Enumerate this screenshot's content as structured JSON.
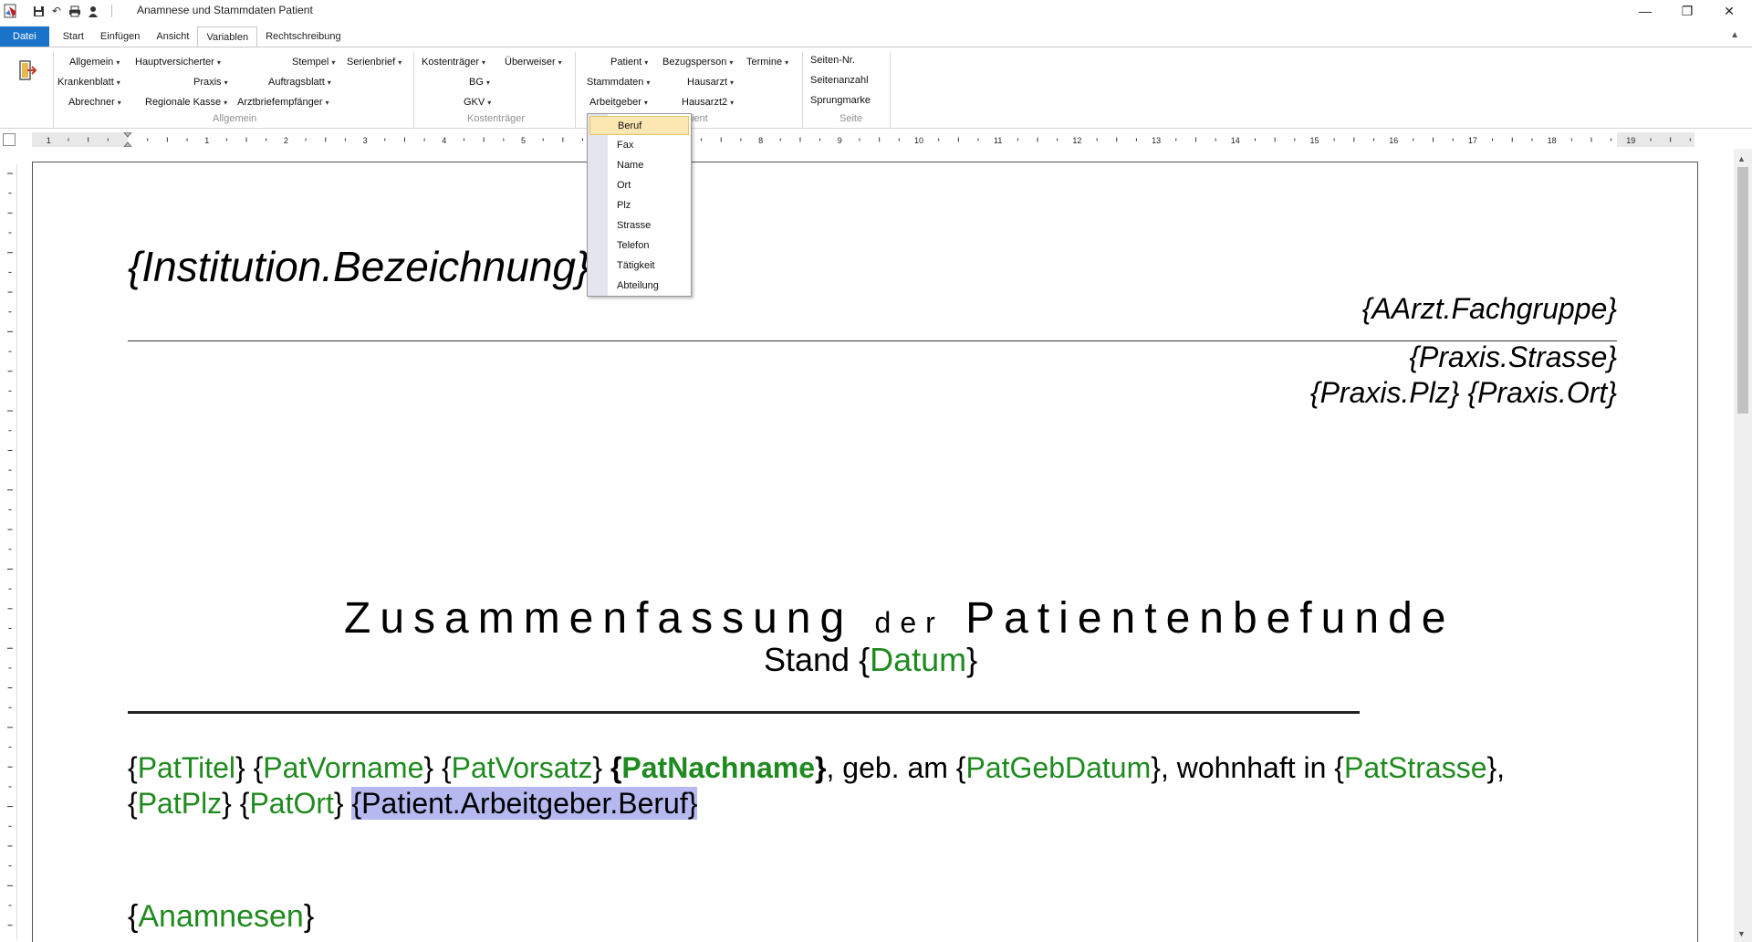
{
  "window": {
    "title": "Anamnese und Stammdaten Patient",
    "controls": {
      "minimize": "—",
      "restore": "❐",
      "close": "✕"
    }
  },
  "tabs": [
    {
      "label": "Datei"
    },
    {
      "label": "Start"
    },
    {
      "label": "Einfügen"
    },
    {
      "label": "Ansicht"
    },
    {
      "label": "Variablen"
    },
    {
      "label": "Rechtschreibung"
    }
  ],
  "ribbon": {
    "allgemein": {
      "items": [
        "Allgemein",
        "Hauptversicherter",
        "Stempel",
        "Serienbrief",
        "Krankenblatt",
        "Praxis",
        "Auftragsblatt",
        "Abrechner",
        "Regionale Kasse",
        "Arztbriefempfänger"
      ],
      "group_label": "Allgemein"
    },
    "kostentraeger": {
      "items": [
        "Kostenträger",
        "Überweiser",
        "BG",
        "GKV"
      ],
      "group_label": "Kostenträger"
    },
    "patient": {
      "items": [
        "Patient",
        "Bezugsperson",
        "Termine",
        "Stammdaten",
        "Hausarzt",
        "Arbeitgeber",
        "Hausarzt2"
      ],
      "group_label": "ient"
    },
    "seite": {
      "items": [
        "Seiten-Nr.",
        "Seitenanzahl",
        "Sprungmarke"
      ],
      "group_label": "Seite"
    }
  },
  "ruler": {
    "numbers": [
      "1",
      "1",
      "2",
      "3",
      "4",
      "5",
      "6",
      "7",
      "8",
      "9",
      "10",
      "11",
      "12",
      "13",
      "14",
      "15",
      "16",
      "17",
      "18",
      "19"
    ]
  },
  "dropdown": {
    "items": [
      "Beruf",
      "Fax",
      "Name",
      "Ort",
      "Plz",
      "Strasse",
      "Telefon",
      "Tätigkeit",
      "Abteilung"
    ],
    "selected": "Beruf"
  },
  "document": {
    "institution": "{Institution.Bezeichnung}",
    "fachgruppe": "{AArzt.Fachgruppe}",
    "praxis_strasse": "{Praxis.Strasse}",
    "praxis_plz_ort": "{Praxis.Plz} {Praxis.Ort}",
    "heading_part1": "Zusammenfassung",
    "heading_part2": "der",
    "heading_part3": "Patientenbefunde",
    "stand_label": "Stand",
    "datum": "Datum",
    "pat_titel": "PatTitel",
    "pat_vorname": "PatVorname",
    "pat_vorsatz": "PatVorsatz",
    "pat_nachname": "PatNachname",
    "geb_am": ", geb. am ",
    "pat_gebdatum": "PatGebDatum",
    "wohnhaft_in": ", wohnhaft in ",
    "pat_strasse": "PatStrasse",
    "pat_plz": "PatPlz",
    "pat_ort": "PatOrt",
    "arbeitgeber_beruf": "{Patient.Arbeitgeber.Beruf}",
    "anamnesen": "Anamnesen"
  },
  "colors": {
    "file_tab": "#1a73c9",
    "variable_green": "#1f8a1f",
    "selection": "#b5b9f0",
    "menu_highlight": "#fce7b2"
  }
}
